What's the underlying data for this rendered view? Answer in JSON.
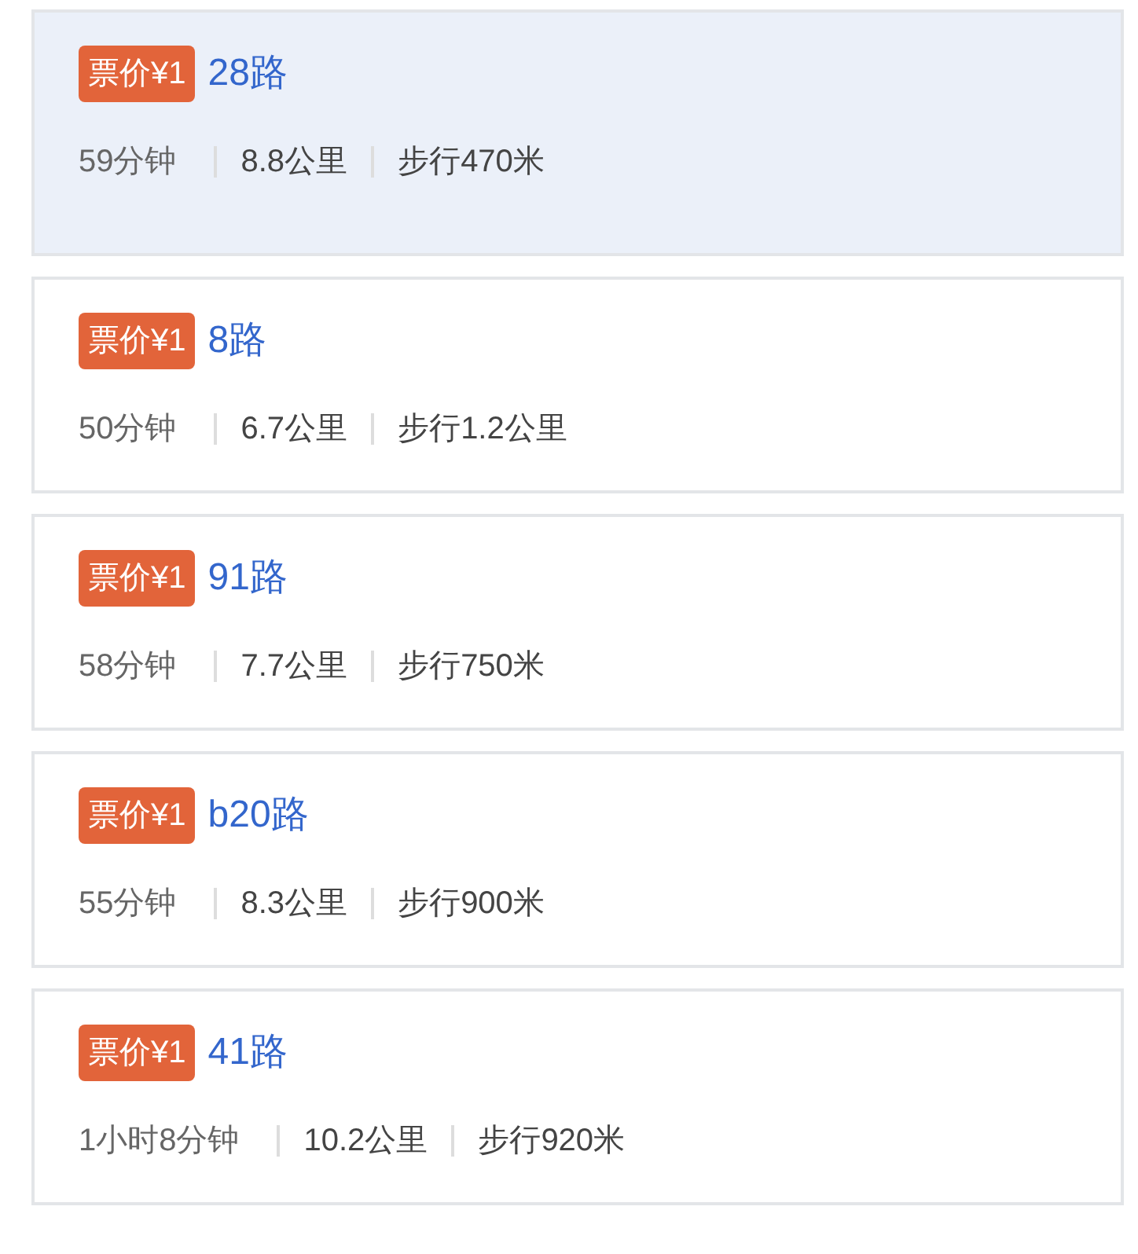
{
  "routes": [
    {
      "price": "票价¥1",
      "name": "28路",
      "time": "59分钟",
      "distance": "8.8公里",
      "walk": "步行470米",
      "selected": true
    },
    {
      "price": "票价¥1",
      "name": "8路",
      "time": "50分钟",
      "distance": "6.7公里",
      "walk": "步行1.2公里",
      "selected": false
    },
    {
      "price": "票价¥1",
      "name": "91路",
      "time": "58分钟",
      "distance": "7.7公里",
      "walk": "步行750米",
      "selected": false
    },
    {
      "price": "票价¥1",
      "name": "b20路",
      "time": "55分钟",
      "distance": "8.3公里",
      "walk": "步行900米",
      "selected": false
    },
    {
      "price": "票价¥1",
      "name": "41路",
      "time": "1小时8分钟",
      "distance": "10.2公里",
      "walk": "步行920米",
      "selected": false
    }
  ]
}
